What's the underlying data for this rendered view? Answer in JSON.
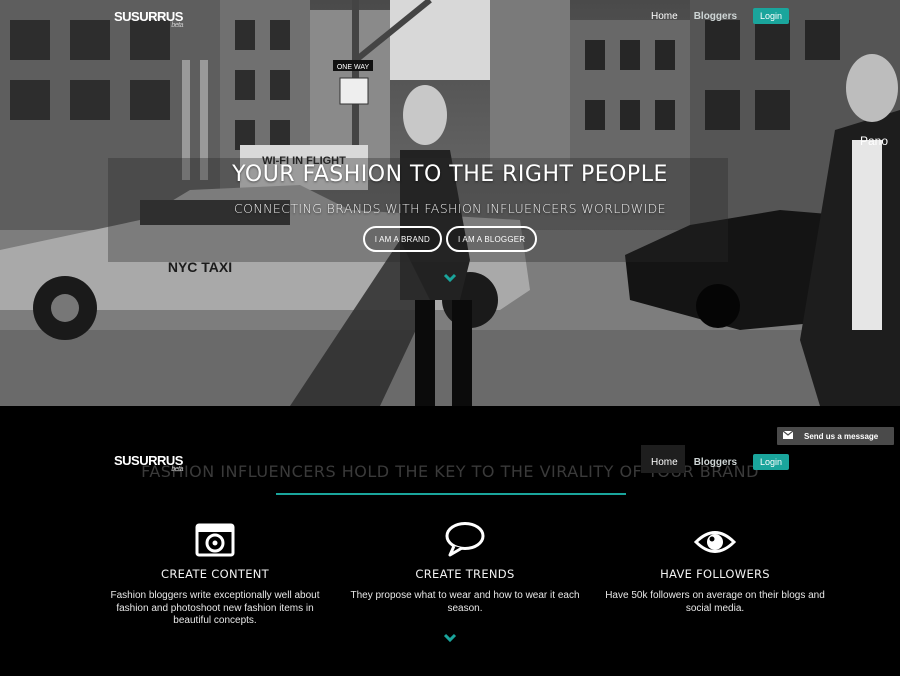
{
  "brand": {
    "name": "SUSURRUS",
    "tag": "beta"
  },
  "top_nav": {
    "home": "Home",
    "bloggers": "Bloggers",
    "login": "Login"
  },
  "hero": {
    "title": "YOUR FASHION TO THE RIGHT PEOPLE",
    "subtitle": "CONNECTING BRANDS WITH FASHION INFLUENCERS WORLDWIDE",
    "cta_brand": "I AM A BRAND",
    "cta_blogger": "I AM A BLOGGER",
    "scene_signs": {
      "one_way": "ONE WAY",
      "taxi": "NYC TAXI",
      "bus": "WI-FI IN FLIGHT",
      "store": "Pano"
    }
  },
  "sticky_nav": {
    "home": "Home",
    "bloggers": "Bloggers",
    "login": "Login"
  },
  "section": {
    "title": "FASHION INFLUENCERS HOLD THE KEY TO THE VIRALITY OF YOUR BRAND",
    "features": [
      {
        "icon": "camera-icon",
        "title": "CREATE CONTENT",
        "text": "Fashion bloggers write exceptionally well about fashion and photoshoot new fashion items in beautiful concepts."
      },
      {
        "icon": "chat-bubble-icon",
        "title": "CREATE TRENDS",
        "text": "They propose what to wear and how to wear it each season."
      },
      {
        "icon": "eye-icon",
        "title": "HAVE FOLLOWERS",
        "text": "Have 50k followers on average on their blogs and social media."
      }
    ]
  },
  "message_widget": {
    "label": "Send us a message",
    "icon": "envelope-icon"
  },
  "colors": {
    "accent": "#1aa59c",
    "background": "#000000"
  }
}
